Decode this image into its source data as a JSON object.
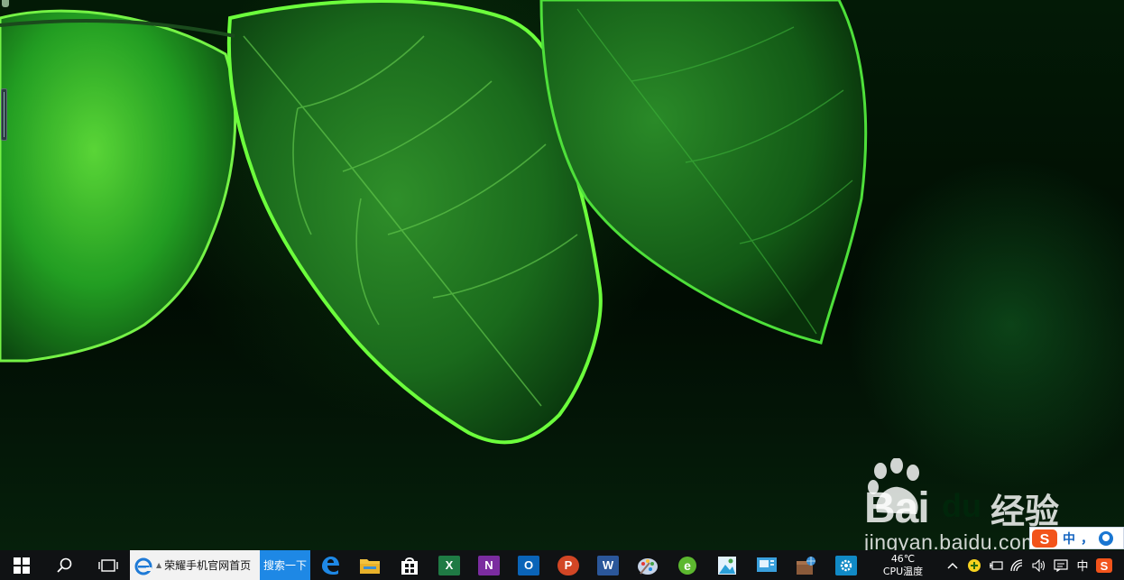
{
  "desktop": {
    "wallpaper": "green-leaves",
    "watermark": {
      "logo_bai": "Bai",
      "logo_du": "du",
      "logo_cn": "经验",
      "url": "jingyan.baidu.com"
    }
  },
  "ime_bar": {
    "mode": "中",
    "punct": "，",
    "icon": "sogou-ime-icon"
  },
  "taskbar": {
    "start_icon": "windows-logo-icon",
    "search_icon": "search-icon",
    "task_view_icon": "task-view-icon",
    "searchbox": {
      "text": "荣耀手机官网首页",
      "button": "搜索一下"
    },
    "pinned_apps": [
      {
        "name": "edge",
        "icon": "edge-icon",
        "color": "#1e88e5"
      },
      {
        "name": "file-explorer",
        "icon": "folder-icon",
        "color": "#f2c23e"
      },
      {
        "name": "store",
        "icon": "store-icon",
        "color": "#ffffff"
      },
      {
        "name": "excel",
        "icon": "excel-icon",
        "letter": "X",
        "color": "#1f7a44"
      },
      {
        "name": "onenote",
        "icon": "onenote-icon",
        "letter": "N",
        "color": "#7b2ca0"
      },
      {
        "name": "outlook",
        "icon": "outlook-icon",
        "letter": "O",
        "color": "#0a64b8"
      },
      {
        "name": "powerpoint",
        "icon": "powerpoint-icon",
        "letter": "P",
        "color": "#d24625"
      },
      {
        "name": "word",
        "icon": "word-icon",
        "letter": "W",
        "color": "#2b579a"
      },
      {
        "name": "paint",
        "icon": "paint-icon",
        "color": "#c7d4e8"
      },
      {
        "name": "360-browser",
        "icon": "browser-360-icon",
        "color": "#5cb82f"
      },
      {
        "name": "photos",
        "icon": "photos-icon",
        "color": "#2a9fd8"
      },
      {
        "name": "media",
        "icon": "media-icon",
        "color": "#3aa0dd"
      },
      {
        "name": "network-tool",
        "icon": "globe-box-icon",
        "color": "#8a5a3a"
      },
      {
        "name": "settings",
        "icon": "gear-icon",
        "color": "#1189c5"
      }
    ],
    "cpu_temp": {
      "value": "46℃",
      "label": "CPU温度"
    },
    "tray": {
      "chevron_icon": "chevron-up-icon",
      "ime_lang": "中",
      "icons": [
        "add-icon",
        "battery-plug-icon",
        "wifi-icon",
        "volume-icon",
        "action-center-icon",
        "sogou-icon"
      ]
    }
  }
}
